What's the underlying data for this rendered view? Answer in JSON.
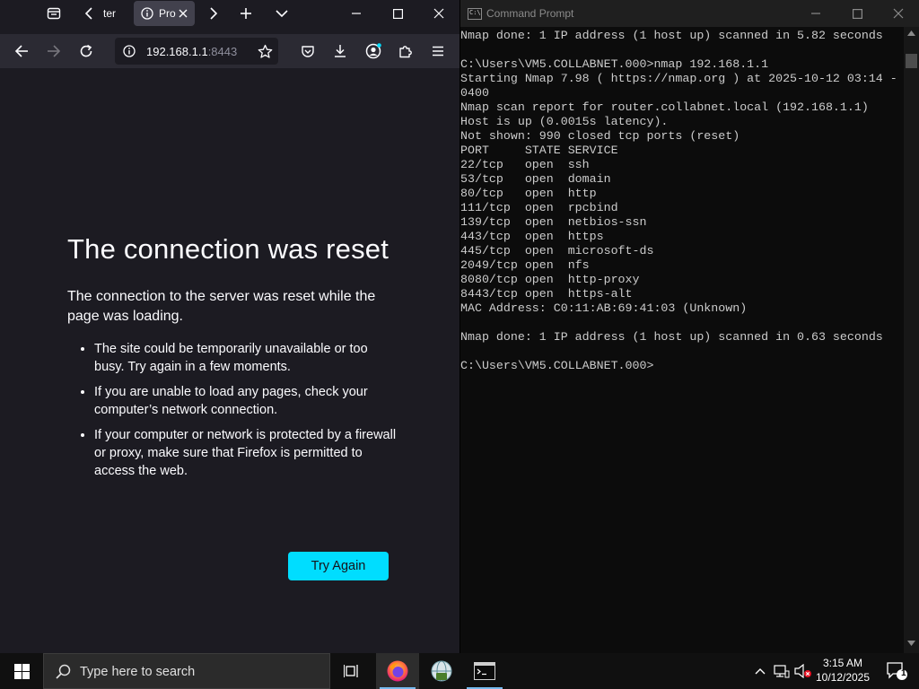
{
  "browser": {
    "tabs": [
      {
        "label": "ter",
        "active": false
      },
      {
        "label": "Pro",
        "active": true
      }
    ],
    "url": {
      "host": "192.168.1.1",
      "port": ":8443"
    },
    "error_page": {
      "title": "The connection was reset",
      "description": "The connection to the server was reset while the page was loading.",
      "bullets": [
        "The site could be temporarily unavailable or too busy. Try again in a few moments.",
        "If you are unable to load any pages, check your computer’s network connection.",
        "If your computer or network is protected by a firewall or proxy, make sure that Firefox is permitted to access the web."
      ],
      "try_again_label": "Try Again"
    }
  },
  "terminal": {
    "title": "Command Prompt",
    "icon_label": "C:\\",
    "output": "Nmap done: 1 IP address (1 host up) scanned in 5.82 seconds\n\nC:\\Users\\VM5.COLLABNET.000>nmap 192.168.1.1\nStarting Nmap 7.98 ( https://nmap.org ) at 2025-10-12 03:14 -\n0400\nNmap scan report for router.collabnet.local (192.168.1.1)\nHost is up (0.0015s latency).\nNot shown: 990 closed tcp ports (reset)\nPORT     STATE SERVICE\n22/tcp   open  ssh\n53/tcp   open  domain\n80/tcp   open  http\n111/tcp  open  rpcbind\n139/tcp  open  netbios-ssn\n443/tcp  open  https\n445/tcp  open  microsoft-ds\n2049/tcp open  nfs\n8080/tcp open  http-proxy\n8443/tcp open  https-alt\nMAC Address: C0:11:AB:69:41:03 (Unknown)\n\nNmap done: 1 IP address (1 host up) scanned in 0.63 seconds\n\nC:\\Users\\VM5.COLLABNET.000>"
  },
  "taskbar": {
    "search_placeholder": "Type here to search",
    "time": "3:15 AM",
    "date": "10/12/2025",
    "notification_count": "1"
  },
  "colors": {
    "firefox_bg": "#1c1b22",
    "toolbar_bg": "#2b2a33",
    "accent_button": "#00ddff",
    "console_text": "#cccccc",
    "console_bg": "#0c0c0c"
  }
}
